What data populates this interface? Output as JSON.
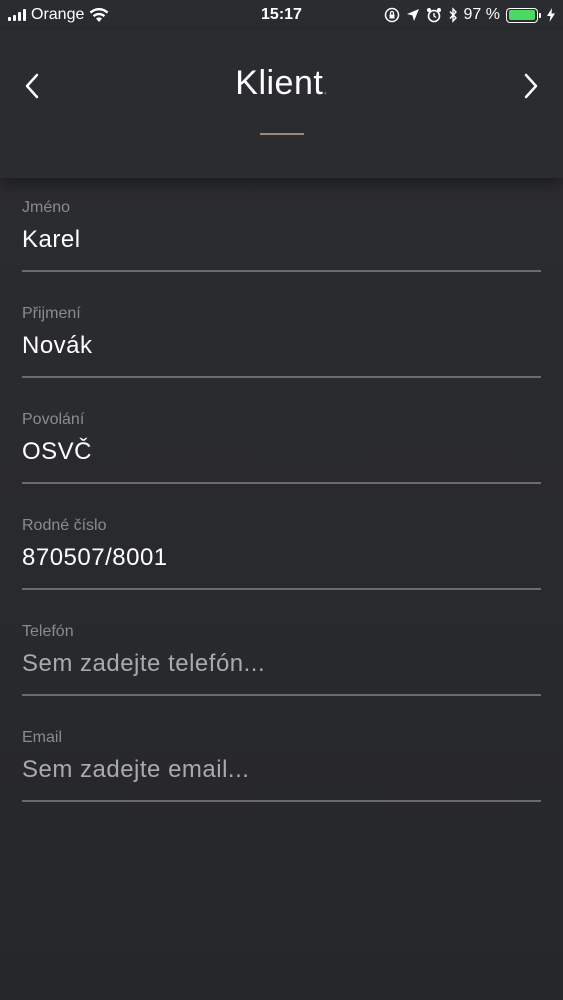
{
  "status_bar": {
    "carrier": "Orange",
    "time": "15:17",
    "battery_text": "97 %",
    "battery_level": 0.97,
    "icons": [
      "signal-icon",
      "wifi-icon",
      "screen-lock-icon",
      "location-icon",
      "alarm-icon",
      "bluetooth-icon",
      "battery-icon",
      "charging-icon"
    ]
  },
  "header": {
    "title": "Klient",
    "title_dot": ".",
    "back_icon": "chevron-left-icon",
    "forward_icon": "chevron-right-icon",
    "accent_color": "#9c8a6e"
  },
  "form": {
    "fields": [
      {
        "label": "Jméno",
        "value": "Karel",
        "placeholder": ""
      },
      {
        "label": "Přijmení",
        "value": "Novák",
        "placeholder": ""
      },
      {
        "label": "Povolání",
        "value": "OSVČ",
        "placeholder": ""
      },
      {
        "label": "Rodné číslo",
        "value": "870507/8001",
        "placeholder": ""
      },
      {
        "label": "Telefón",
        "value": "",
        "placeholder": "Sem zadejte telefón..."
      },
      {
        "label": "Email",
        "value": "",
        "placeholder": "Sem zadejte email..."
      }
    ]
  }
}
